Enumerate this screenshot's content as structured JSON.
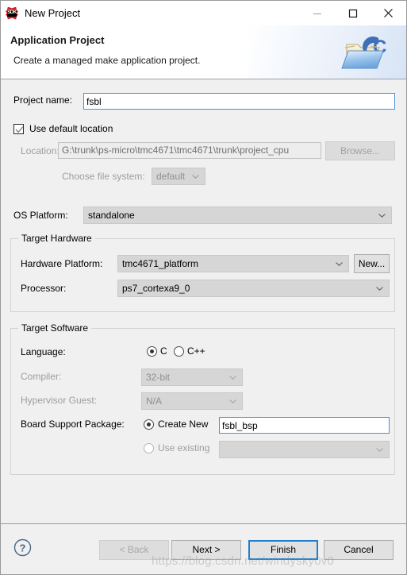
{
  "window": {
    "title": "New Project",
    "icon": "sdk-icon",
    "minimize_label": "—",
    "maximize_label": "□",
    "close_label": "✕"
  },
  "header": {
    "title": "Application Project",
    "subtitle": "Create a managed make application project.",
    "icon": "c-folder-icon"
  },
  "form": {
    "project_name_label": "Project name:",
    "project_name_value": "fsbl",
    "use_default_location_label": "Use default location",
    "use_default_location_checked": true,
    "location_label": "Location:",
    "location_value": "G:\\trunk\\ps-micro\\tmc4671\\tmc4671\\trunk\\project_cpu",
    "browse_label": "Browse...",
    "choose_file_system_label": "Choose file system:",
    "file_system_value": "default",
    "os_platform_label": "OS Platform:",
    "os_platform_value": "standalone"
  },
  "target_hardware": {
    "group_title": "Target Hardware",
    "hardware_platform_label": "Hardware Platform:",
    "hardware_platform_value": "tmc4671_platform",
    "new_label": "New...",
    "processor_label": "Processor:",
    "processor_value": "ps7_cortexa9_0"
  },
  "target_software": {
    "group_title": "Target Software",
    "language_label": "Language:",
    "language_c_label": "C",
    "language_cpp_label": "C++",
    "language_selected": "C",
    "compiler_label": "Compiler:",
    "compiler_value": "32-bit",
    "hypervisor_label": "Hypervisor Guest:",
    "hypervisor_value": "N/A",
    "bsp_label": "Board Support Package:",
    "bsp_create_new_label": "Create New",
    "bsp_create_new_value": "fsbl_bsp",
    "bsp_use_existing_label": "Use existing",
    "bsp_use_existing_value": "",
    "bsp_selected": "Create New"
  },
  "footer": {
    "help_icon": "question-mark-icon",
    "back_label": "< Back",
    "next_label": "Next >",
    "finish_label": "Finish",
    "cancel_label": "Cancel"
  },
  "watermark": {
    "text": "https://blog.csdn.net/windysky0v0"
  }
}
